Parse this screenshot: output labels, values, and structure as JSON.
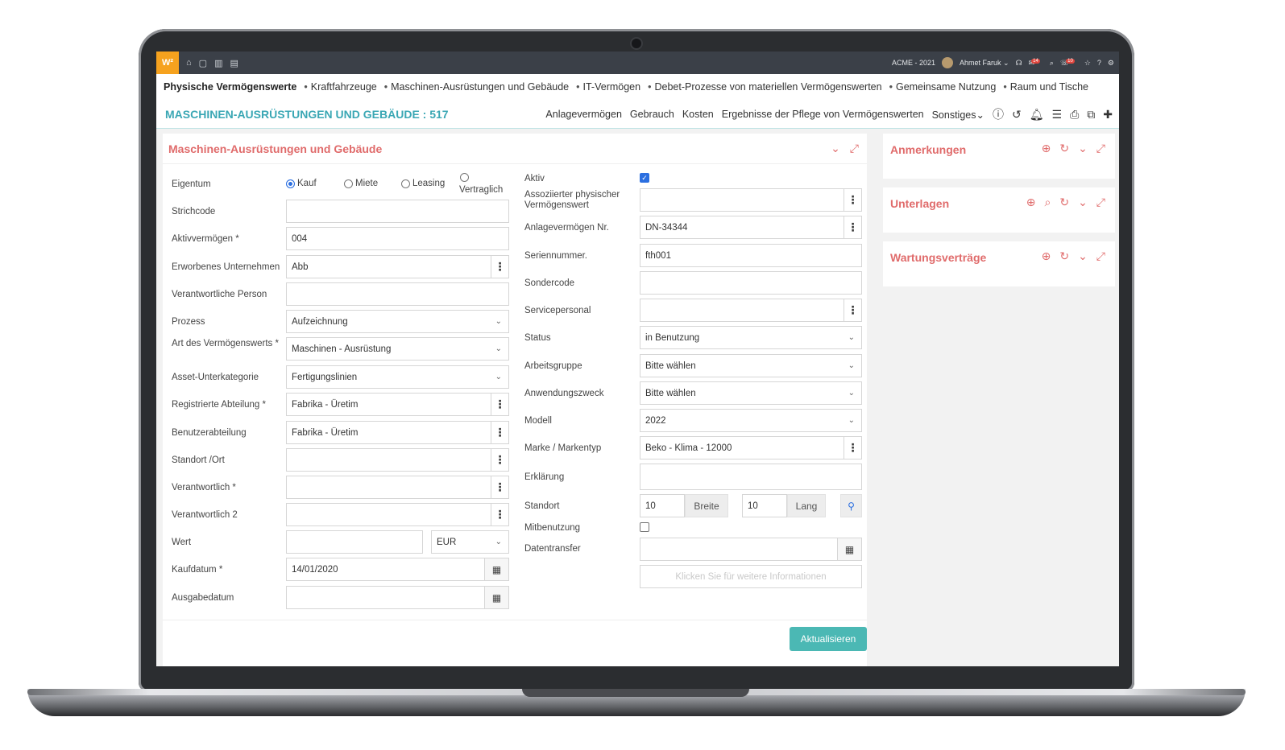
{
  "topbar": {
    "logo": "W²",
    "company": "ACME - 2021",
    "user": "Ahmet Faruk",
    "badge_messages": "14",
    "badge_notifications": "10"
  },
  "nav": {
    "items": [
      "Physische Vermögenswerte",
      "Kraftfahrzeuge",
      "Maschinen-Ausrüstungen und Gebäude",
      "IT-Vermögen",
      "Debet-Prozesse von materiellen Vermögenswerten",
      "Gemeinsame Nutzung",
      "Raum und Tische"
    ]
  },
  "page": {
    "title": "MASCHINEN-AUSRÜSTUNGEN UND GEBÄUDE : 517",
    "tabs": [
      "Anlagevermögen",
      "Gebrauch",
      "Kosten",
      "Ergebnisse der Pflege von Vermögenswerten",
      "Sonstiges"
    ]
  },
  "card": {
    "title": "Maschinen-Ausrüstungen und Gebäude"
  },
  "left": {
    "eigentum": {
      "label": "Eigentum",
      "options": [
        "Kauf",
        "Miete",
        "Leasing",
        "Vertraglich"
      ],
      "selected": "Kauf"
    },
    "strichcode": {
      "label": "Strichcode",
      "value": ""
    },
    "aktiv": {
      "label": "Aktivvermögen *",
      "value": "004"
    },
    "erworbenes": {
      "label": "Erworbenes Unternehmen",
      "value": "Abb"
    },
    "verantwortliche": {
      "label": "Verantwortliche Person",
      "value": ""
    },
    "prozess": {
      "label": "Prozess",
      "value": "Aufzeichnung"
    },
    "art": {
      "label": "Art des Vermögenswerts *",
      "value": "Maschinen - Ausrüstung"
    },
    "unterkategorie": {
      "label": "Asset-Unterkategorie",
      "value": "Fertigungslinien"
    },
    "registrierte": {
      "label": "Registrierte Abteilung *",
      "value": "Fabrika - Üretim"
    },
    "benutzerabteilung": {
      "label": "Benutzerabteilung",
      "value": "Fabrika - Üretim"
    },
    "standort": {
      "label": "Standort /Ort",
      "value": ""
    },
    "verantwortlich": {
      "label": "Verantwortlich *",
      "value": ""
    },
    "verantwortlich2": {
      "label": "Verantwortlich 2",
      "value": ""
    },
    "wert": {
      "label": "Wert",
      "value": "",
      "currency": "EUR"
    },
    "kaufdatum": {
      "label": "Kaufdatum *",
      "value": "14/01/2020"
    },
    "ausgabedatum": {
      "label": "Ausgabedatum",
      "value": ""
    }
  },
  "right": {
    "aktiv": {
      "label": "Aktiv",
      "checked": true
    },
    "assoziierter": {
      "label": "Assoziierter physischer Vermögenswert",
      "value": ""
    },
    "anlage_nr": {
      "label": "Anlagevermögen Nr.",
      "value": "DN-34344"
    },
    "seriennummer": {
      "label": "Seriennummer.",
      "value": "fth001"
    },
    "sondercode": {
      "label": "Sondercode",
      "value": ""
    },
    "servicepersonal": {
      "label": "Servicepersonal",
      "value": ""
    },
    "status": {
      "label": "Status",
      "value": "in Benutzung"
    },
    "arbeitsgruppe": {
      "label": "Arbeitsgruppe",
      "value": "Bitte wählen"
    },
    "anwendungszweck": {
      "label": "Anwendungszweck",
      "value": "Bitte wählen"
    },
    "modell": {
      "label": "Modell",
      "value": "2022"
    },
    "marke": {
      "label": "Marke / Markentyp",
      "value": "Beko - Klima - 12000"
    },
    "erklaerung": {
      "label": "Erklärung",
      "value": ""
    },
    "standort": {
      "label": "Standort",
      "breite_value": "10",
      "breite_label": "Breite",
      "lang_value": "10",
      "lang_label": "Lang"
    },
    "mitbenutzung": {
      "label": "Mitbenutzung",
      "checked": false
    },
    "datentransfer": {
      "label": "Datentransfer",
      "value": ""
    },
    "info_button": "Klicken Sie für weitere Informationen"
  },
  "update_button": "Aktualisieren",
  "side": {
    "anmerkungen": "Anmerkungen",
    "unterlagen": "Unterlagen",
    "wartung": "Wartungsverträge"
  },
  "colors": {
    "accent": "#3aa7b4",
    "card_title": "#e06b6b",
    "button": "#4bb8b4",
    "topbar": "#3b4048",
    "logo": "#f6a21e"
  }
}
